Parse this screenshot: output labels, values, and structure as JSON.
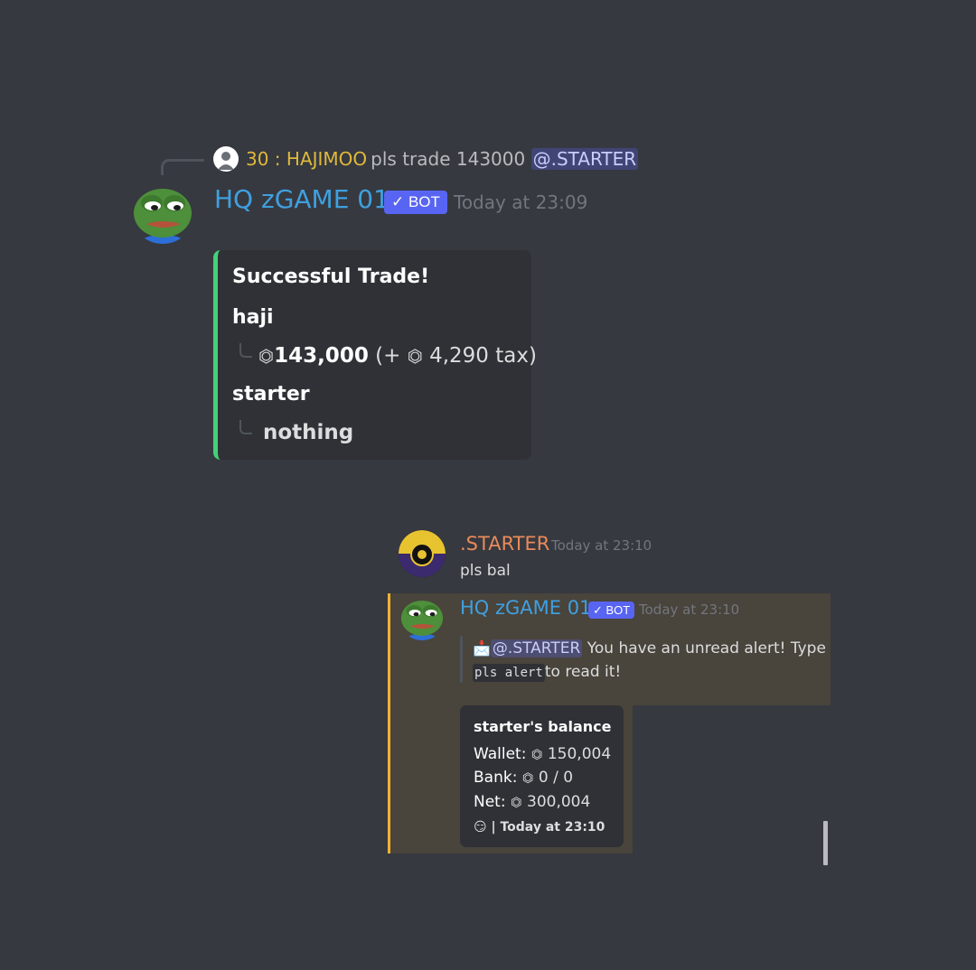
{
  "reply": {
    "name": "30 : HAJIMOO",
    "text": "pls trade 143000",
    "mention": "@.STARTER"
  },
  "message1": {
    "author": "HQ zGAME 01",
    "bot_tag": "✓ BOT",
    "timestamp": "Today at 23:09",
    "embed": {
      "accent_color": "#43d17a",
      "title": "Successful Trade!",
      "field1_name": "haji",
      "field1_amount": "143,000",
      "field1_tax_prefix": "(+",
      "field1_tax": "4,290 tax)",
      "field2_name": "starter",
      "field2_value": "nothing"
    }
  },
  "message2": {
    "author": ".STARTER",
    "timestamp": "Today at 23:10",
    "text": "pls bal"
  },
  "message3": {
    "author": "HQ zGAME 01",
    "bot_tag": "✓ BOT",
    "timestamp": "Today at 23:10",
    "alert_mention": "@.STARTER",
    "alert_text": "You have an unread alert! Type",
    "alert_code": "pls alert",
    "alert_text2": "to read it!",
    "embed": {
      "title": "starter's balance",
      "wallet_label": "Wallet:",
      "wallet_value": "150,004",
      "bank_label": "Bank:",
      "bank_value": "0 / 0",
      "net_label": "Net:",
      "net_value": "300,004",
      "footer": "| Today at 23:10"
    }
  },
  "icons": {
    "coin": "⏣",
    "emoji": "😏",
    "envelope": "📩"
  },
  "colors": {
    "background": "#36393f",
    "embed_bg": "#2f3136",
    "bot_blue": "#5865f2",
    "bot_name": "#3fa0e0",
    "reply_name": "#e0b93b",
    "starter_name": "#ea8a5b",
    "highlight_border": "#f0b232"
  }
}
